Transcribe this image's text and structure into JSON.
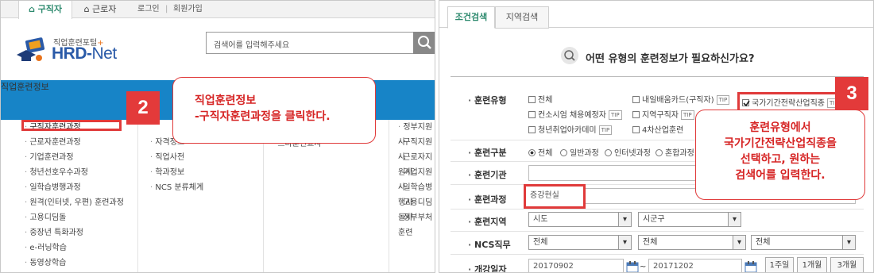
{
  "left": {
    "topnav": {
      "tab_jobseeker": "⌂ 구직자",
      "tab_worker": "⌂ 근로자",
      "login": "로그인",
      "sep": "|",
      "signup": "회원가입"
    },
    "logo": {
      "sub": "직업훈련포털",
      "plus": "+",
      "main": "HRD-",
      "net": "Net"
    },
    "search": {
      "placeholder": "검색어를 입력해주세요"
    },
    "gnb": {
      "active": "직업훈련정보",
      "partial_left": "일",
      "partial_right": "훈련"
    },
    "menu_col1": [
      "구직자훈련과정",
      "근로자훈련과정",
      "기업훈련과정",
      "청년선호우수과정",
      "일학습병행과정",
      "원격(인터넷, 우편) 훈련과정",
      "고용디딤돌",
      "중장년 특화과정",
      "e-러닝학습",
      "동영상학습"
    ],
    "menu_col2": [
      "",
      "자격정보",
      "직업사전",
      "학과정보",
      "NCS 분류체계"
    ],
    "menu_col3": [
      "",
      "스타훈련교사"
    ],
    "menu_col4": [
      "정부지원사",
      "구직지원사",
      "근로자지원사",
      "기업지원사",
      "일학습병행사",
      "고용디딤돌사",
      "정부부처훈련"
    ],
    "step": "2",
    "callout": {
      "line1": "직업훈련정보",
      "line2": "-구직자훈련과정을 클릭한다."
    }
  },
  "right": {
    "tabs": [
      "조건검색",
      "지역검색"
    ],
    "question": "어떤 유형의 훈련정보가 필요하신가요?",
    "labels": {
      "type": "훈련유형",
      "category": "훈련구분",
      "org": "훈련기관",
      "course": "훈련과정",
      "region": "훈련지역",
      "ncs": "NCS직무",
      "date": "개강일자"
    },
    "types": [
      {
        "label": "전체",
        "tip": "",
        "checked": false
      },
      {
        "label": "내일배움카드(구직자)",
        "tip": "TIP",
        "checked": false
      },
      {
        "label": "국가기간전략산업직종",
        "tip": "TIP",
        "checked": true
      },
      {
        "label": "컨소시엄 채용예정자",
        "tip": "TIP",
        "checked": false
      },
      {
        "label": "지역구직자",
        "tip": "TIP",
        "checked": false
      },
      {
        "label": "청년취업아카데미",
        "tip": "TIP",
        "checked": false
      },
      {
        "label": "4차산업훈련",
        "tip": "",
        "checked": false
      }
    ],
    "categories": [
      {
        "label": "전체",
        "selected": true
      },
      {
        "label": "일반과정",
        "selected": false
      },
      {
        "label": "인터넷과정",
        "selected": false
      },
      {
        "label": "혼합과정",
        "selected": false
      }
    ],
    "course_value": "증강현실",
    "region": {
      "sido": "시도",
      "sigungu": "시군구"
    },
    "ncs": {
      "a": "전체",
      "b": "전체",
      "c": "전체"
    },
    "date": {
      "start": "20170902",
      "tilde": "~",
      "end": "20171202"
    },
    "period_buttons": [
      "1주일",
      "1개월",
      "3개월"
    ],
    "step": "3",
    "callout": {
      "line1": "훈련유형에서",
      "line2": "국가기간전략산업직종을",
      "line3": "선택하고, 원하는",
      "line4": "검색어를 입력한다."
    }
  },
  "colors": {
    "gnb": "#1784c7",
    "active_menu": "#1a6e5c",
    "highlight": "#e03a3a"
  }
}
